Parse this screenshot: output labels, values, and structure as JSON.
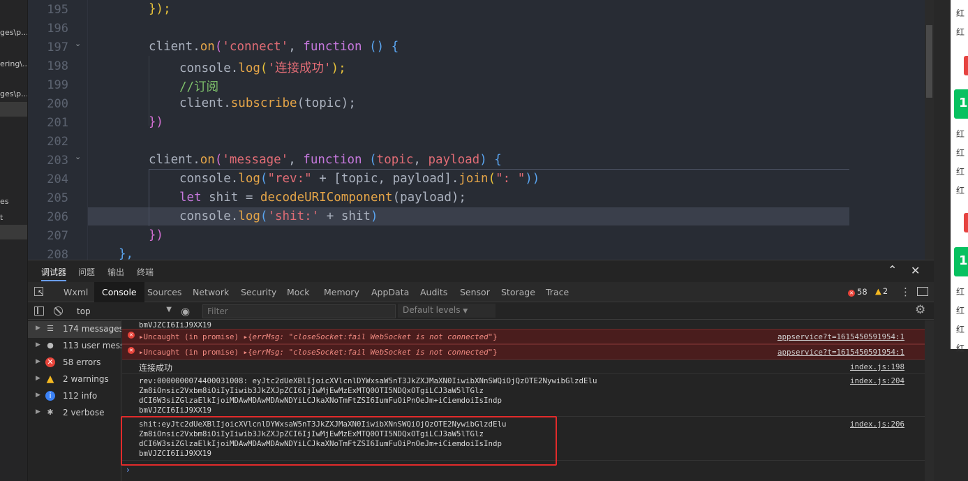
{
  "explorer": {
    "items": [
      "ges\\p...",
      "ering\\...",
      "ges\\p...",
      "es",
      "t"
    ]
  },
  "editor": {
    "lines": [
      {
        "num": "195"
      },
      {
        "num": "196"
      },
      {
        "num": "197"
      },
      {
        "num": "198"
      },
      {
        "num": "199"
      },
      {
        "num": "200"
      },
      {
        "num": "201"
      },
      {
        "num": "202"
      },
      {
        "num": "203"
      },
      {
        "num": "204"
      },
      {
        "num": "205"
      },
      {
        "num": "206"
      },
      {
        "num": "207"
      },
      {
        "num": "208"
      }
    ],
    "code": {
      "l195": "});",
      "l197_a": "client.",
      "l197_on": "on",
      "l197_b": "(",
      "l197_str": "'connect'",
      "l197_c": ", ",
      "l197_fn": "function",
      "l197_d": " () {",
      "l198_a": "console.",
      "l198_log": "log",
      "l198_b": "(",
      "l198_str": "'连接成功'",
      "l198_c": ");",
      "l199": "//订阅",
      "l200_a": "client.",
      "l200_sub": "subscribe",
      "l200_b": "(topic);",
      "l201": "})",
      "l203_a": "client.",
      "l203_on": "on",
      "l203_b": "(",
      "l203_str": "'message'",
      "l203_c": ", ",
      "l203_fn": "function",
      "l203_d": " (",
      "l203_p1": "topic",
      "l203_e": ", ",
      "l203_p2": "payload",
      "l203_f": ") {",
      "l204_a": "console.",
      "l204_log": "log",
      "l204_b": "(",
      "l204_str": "\"rev:\"",
      "l204_c": " + [topic, payload].",
      "l204_join": "join",
      "l204_d": "(",
      "l204_str2": "\": \"",
      "l204_e": "))",
      "l205_let": "let",
      "l205_a": " shit = ",
      "l205_fn": "decodeURIComponent",
      "l205_b": "(payload);",
      "l206_a": "console.",
      "l206_log": "log",
      "l206_b": "(",
      "l206_str": "'shit:'",
      "l206_c": " + shit",
      "l206_d": ")",
      "l207": "})",
      "l208": "},"
    }
  },
  "devtools": {
    "top_tabs": [
      "调试器",
      "问题",
      "输出",
      "终端"
    ],
    "tabs": [
      "Wxml",
      "Console",
      "Sources",
      "Network",
      "Security",
      "Mock",
      "Memory",
      "AppData",
      "Audits",
      "Sensor",
      "Storage",
      "Trace"
    ],
    "error_count": "58",
    "warning_count": "2",
    "context": "top",
    "filter_placeholder": "Filter",
    "levels": "Default levels",
    "sidebar": [
      {
        "label": "174 messages",
        "icon": "list-icon"
      },
      {
        "label": "113 user mess...",
        "icon": "user-icon"
      },
      {
        "label": "58 errors",
        "icon": "error-icon"
      },
      {
        "label": "2 warnings",
        "icon": "warning-icon"
      },
      {
        "label": "112 info",
        "icon": "info-icon"
      },
      {
        "label": "2 verbose",
        "icon": "verbose-icon"
      }
    ],
    "log": {
      "partial_top": "bmVJZCI6IiJ9XX19",
      "err1_prefix": "Uncaught (in promise)",
      "err1_key": "errMsg:",
      "err1_val": "\"closeSocket:fail WebSocket is not connected\"",
      "err1_src": "appservice?t=1615450591954:1",
      "err2_prefix": "Uncaught (in promise)",
      "err2_key": "errMsg:",
      "err2_val": "\"closeSocket:fail WebSocket is not connected\"",
      "err2_src": "appservice?t=1615450591954:1",
      "connected": "连接成功",
      "connected_src": "index.js:198",
      "rev_l1": "rev:0000000074400031008: eyJtc2dUeXBlIjoicXVlcnlDYWxsaW5nT3JkZXJMaXN0IiwibXNnSWQiOjQzOTE2NywibGlzdElu",
      "rev_l2": "Zm8iOnsic2Vxbm8iOiIyIiwib3JkZXJpZCI6IjIwMjEwMzExMTQ0OTI5NDQxOTgiLCJ3aW5lTGlz",
      "rev_l3": "dCI6W3siZGlzaElkIjoiMDAwMDAwMDAwNDYiLCJkaXNoTmFtZSI6IumFuOiPnOeJm+iCiemdoiIsIndp",
      "rev_l4": "bmVJZCI6IiJ9XX19",
      "rev_src": "index.js:204",
      "shit_l1": "shit:eyJtc2dUeXBlIjoicXVlcnlDYWxsaW5nT3JkZXJMaXN0IiwibXNnSWQiOjQzOTE2NywibGlzdElu",
      "shit_l2": "Zm8iOnsic2Vxbm8iOiIyIiwib3JkZXJpZCI6IjIwMjEwMzExMTQ0OTI5NDQxOTgiLCJ3aW5lTGlz",
      "shit_l3": "dCI6W3siZGlzaElkIjoiMDAwMDAwMDAwNDYiLCJkaXNoTmFtZSI6IumFuOiPnOeJm+iCiemdoiIsIndp",
      "shit_l4": "bmVJZCI6IiJ9XX19",
      "shit_src": "index.js:206"
    }
  },
  "phone": {
    "chars": [
      "红",
      "红",
      "红",
      "红",
      "红",
      "红",
      "红",
      "红",
      "红",
      "红"
    ],
    "badge_num": "1"
  },
  "colors": {
    "error_red": "#e8443a",
    "warning_yellow": "#f5b921",
    "highlight_box": "#e22b2b",
    "accent_green": "#07c160"
  }
}
